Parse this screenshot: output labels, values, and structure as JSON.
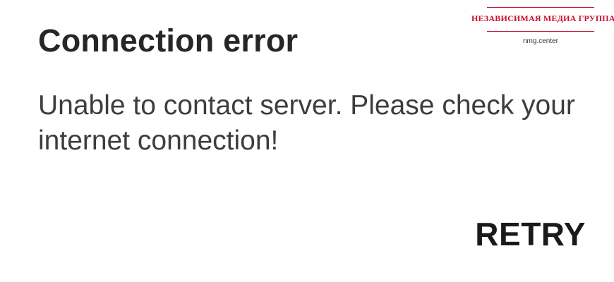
{
  "dialog": {
    "title": "Connection error",
    "message": "Unable to contact server. Please check your internet connection!",
    "retry_label": "RETRY"
  },
  "watermark": {
    "brand": "НЕЗАВИСИМАЯ МЕДИА ГРУППА",
    "site": "nmg.center",
    "accent_color": "#c8102e"
  }
}
